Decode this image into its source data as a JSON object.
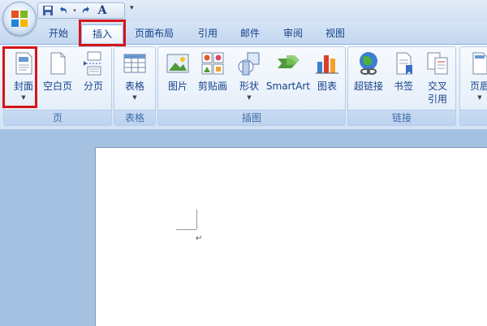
{
  "qat": {
    "font_glyph": "A"
  },
  "tabs": [
    {
      "label": "开始"
    },
    {
      "label": "插入"
    },
    {
      "label": "页面布局"
    },
    {
      "label": "引用"
    },
    {
      "label": "邮件"
    },
    {
      "label": "审阅"
    },
    {
      "label": "视图"
    }
  ],
  "ribbon": {
    "groups": [
      {
        "label": "页",
        "buttons": [
          {
            "label": "封面"
          },
          {
            "label": "空白页"
          },
          {
            "label": "分页"
          }
        ]
      },
      {
        "label": "表格",
        "buttons": [
          {
            "label": "表格"
          }
        ]
      },
      {
        "label": "插图",
        "buttons": [
          {
            "label": "图片"
          },
          {
            "label": "剪贴画"
          },
          {
            "label": "形状"
          },
          {
            "label": "SmartArt"
          },
          {
            "label": "图表"
          }
        ]
      },
      {
        "label": "链接",
        "buttons": [
          {
            "label": "超链接"
          },
          {
            "label": "书签"
          },
          {
            "label": "交叉\n引用"
          }
        ]
      },
      {
        "label": "",
        "buttons": [
          {
            "label": "页眉"
          }
        ]
      }
    ]
  },
  "colors": {
    "highlight": "#d6141a",
    "ribbon_text": "#15428b"
  },
  "document": {
    "paragraph_mark": "↵"
  }
}
